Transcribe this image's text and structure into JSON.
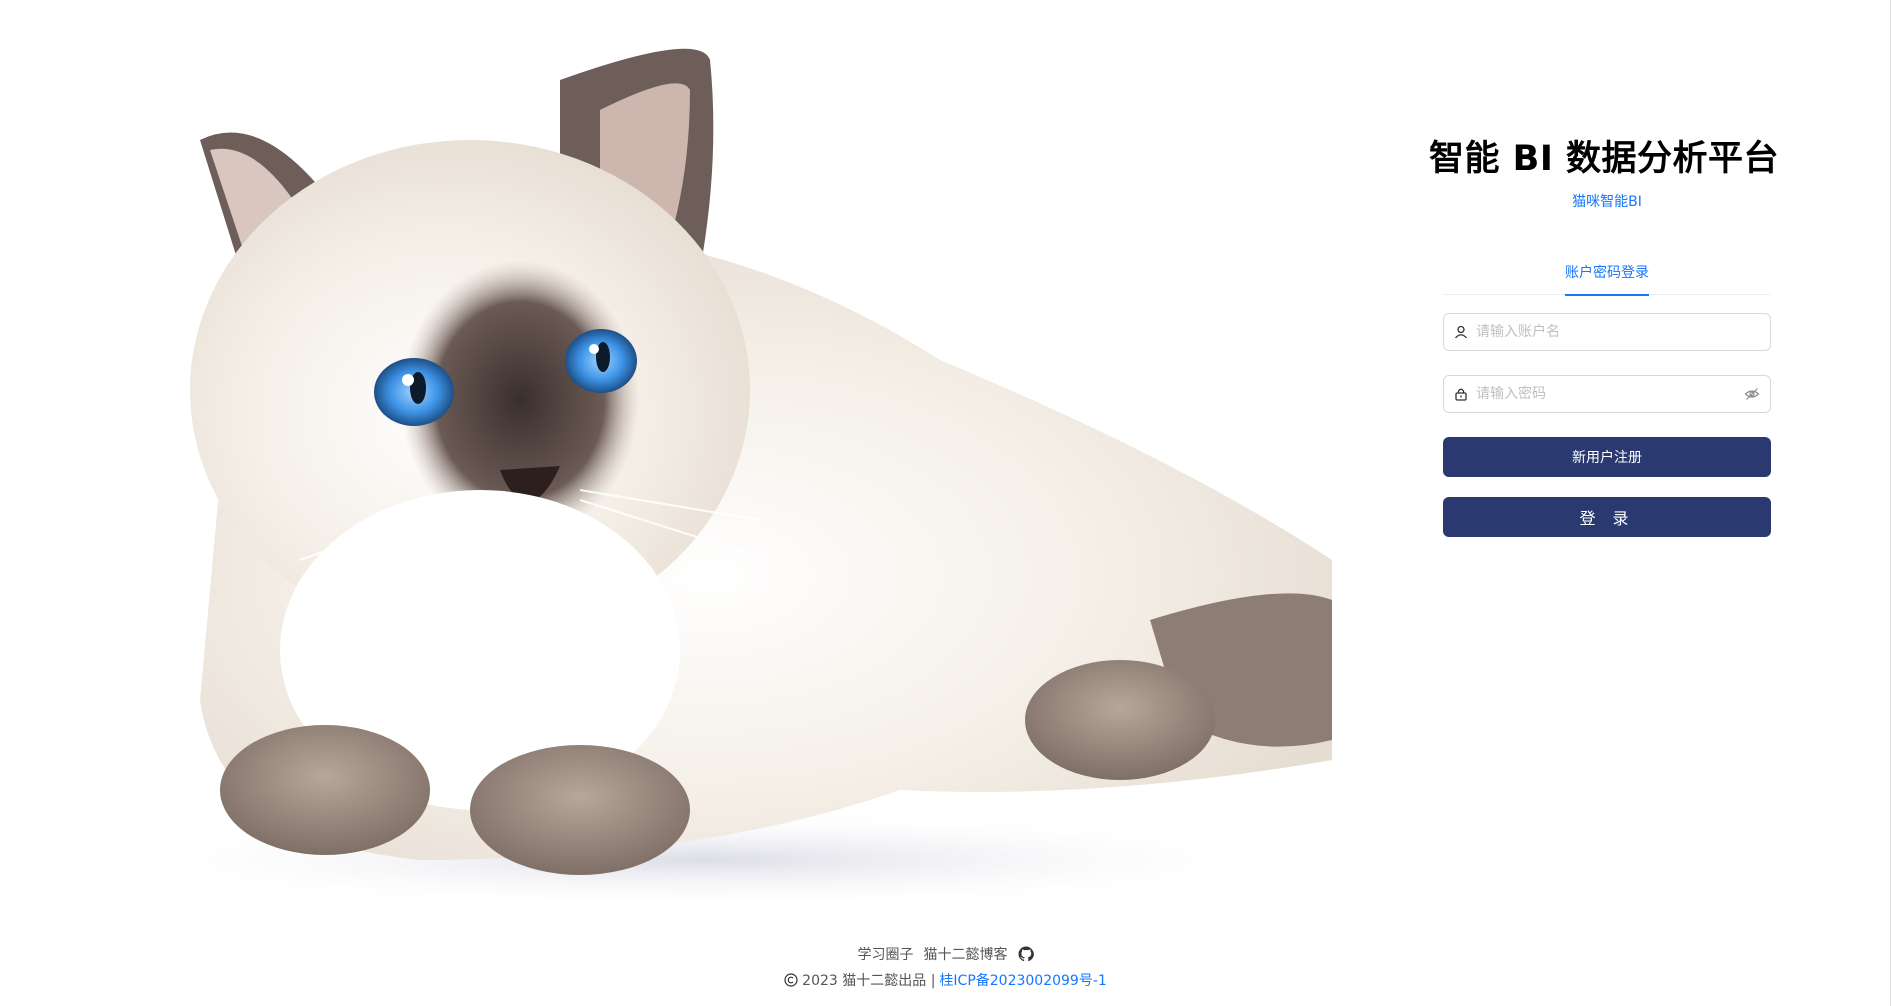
{
  "hero": {
    "image": "ragdoll-kitten-photo"
  },
  "brand": {
    "logo": "cat-face-icon",
    "title": "智能 BI 数据分析平台",
    "subtitle": "猫咪智能BI"
  },
  "tabs": {
    "active": "账户密码登录"
  },
  "form": {
    "username_placeholder": "请输入账户名",
    "password_placeholder": "请输入密码",
    "register_label": "新用户注册",
    "login_label": "登 录"
  },
  "footer": {
    "link1": "学习圈子",
    "link2": "猫十二懿博客",
    "copyright": "2023 猫十二懿出品 |",
    "icp": "桂ICP备2023002099号-1"
  },
  "colors": {
    "accent": "#1677ff",
    "button": "#2a3a70"
  }
}
